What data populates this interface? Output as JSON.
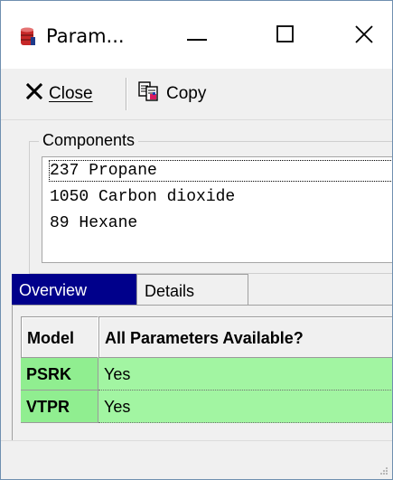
{
  "window": {
    "title": "Param..."
  },
  "toolbar": {
    "close_label": "Close",
    "copy_label": "Copy"
  },
  "components": {
    "group_title": "Components",
    "items": [
      "237 Propane",
      "1050 Carbon dioxide",
      "89 Hexane"
    ],
    "selected_index": 0
  },
  "tabs": [
    {
      "label": "Overview",
      "active": true
    },
    {
      "label": "Details",
      "active": false
    }
  ],
  "grid": {
    "headers": [
      "Model",
      "All Parameters Available?"
    ],
    "rows": [
      {
        "model": "PSRK",
        "available": "Yes"
      },
      {
        "model": "VTPR",
        "available": "Yes"
      }
    ]
  },
  "colors": {
    "active_tab": "#00008b",
    "available_row": "#90ee90",
    "window_bg": "#f0f0f0"
  },
  "icons": {
    "app": "red-database-icon",
    "close": "close-x-icon",
    "copy": "copy-icon",
    "minimize": "minimize-icon",
    "maximize": "maximize-icon",
    "window_close": "window-close-icon"
  }
}
